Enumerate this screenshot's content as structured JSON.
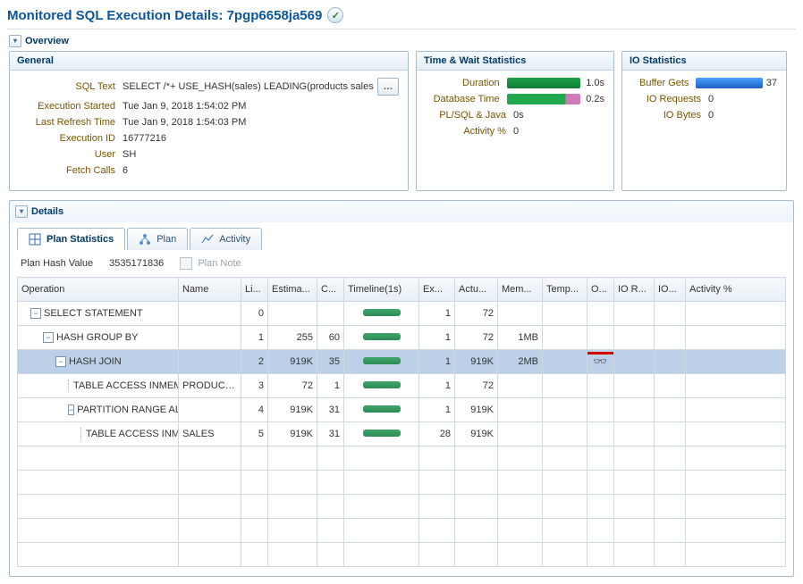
{
  "title": "Monitored SQL Execution Details: 7pgp6658ja569",
  "sections": {
    "overview": "Overview",
    "details": "Details"
  },
  "general": {
    "heading": "General",
    "labels": {
      "sql_text": "SQL Text",
      "exec_started": "Execution Started",
      "last_refresh": "Last Refresh Time",
      "exec_id": "Execution ID",
      "user": "User",
      "fetch_calls": "Fetch Calls"
    },
    "values": {
      "sql_text": "SELECT /*+ USE_HASH(sales) LEADING(products sales",
      "exec_started": "Tue Jan 9, 2018 1:54:02 PM",
      "last_refresh": "Tue Jan 9, 2018 1:54:03 PM",
      "exec_id": "16777216",
      "user": "SH",
      "fetch_calls": "6"
    }
  },
  "tw": {
    "heading": "Time & Wait Statistics",
    "labels": {
      "duration": "Duration",
      "db_time": "Database Time",
      "plsql": "PL/SQL & Java",
      "activity": "Activity %"
    },
    "values": {
      "duration": "1.0s",
      "db_time": "0.2s",
      "plsql": "0s",
      "activity": "0"
    }
  },
  "io": {
    "heading": "IO Statistics",
    "labels": {
      "buffer_gets": "Buffer Gets",
      "io_requests": "IO Requests",
      "io_bytes": "IO Bytes"
    },
    "values": {
      "buffer_gets": "37",
      "io_requests": "0",
      "io_bytes": "0"
    }
  },
  "tabs": {
    "plan_stats": "Plan Statistics",
    "plan": "Plan",
    "activity": "Activity"
  },
  "plan_hash": {
    "label": "Plan Hash Value",
    "value": "3535171836"
  },
  "plan_note": "Plan Note",
  "columns": {
    "operation": "Operation",
    "name": "Name",
    "li": "Li...",
    "estim": "Estima...",
    "c": "C...",
    "timeline": "Timeline(1s)",
    "ex": "Ex...",
    "actu": "Actu...",
    "mem": "Mem...",
    "temp": "Temp...",
    "o": "O...",
    "ior": "IO R...",
    "io": "IO...",
    "activity": "Activity %"
  },
  "rows": [
    {
      "indent": 0,
      "toggle": "-",
      "op": "SELECT STATEMENT",
      "name": "",
      "li": "0",
      "est": "",
      "c": "",
      "tl": true,
      "ex": "1",
      "act": "72",
      "mem": "",
      "o": ""
    },
    {
      "indent": 1,
      "toggle": "-",
      "op": "HASH GROUP BY",
      "name": "",
      "li": "1",
      "est": "255",
      "c": "60",
      "tl": true,
      "ex": "1",
      "act": "72",
      "mem": "1MB",
      "o": ""
    },
    {
      "indent": 2,
      "toggle": "-",
      "op": "HASH JOIN",
      "name": "",
      "li": "2",
      "est": "919K",
      "c": "35",
      "tl": true,
      "ex": "1",
      "act": "919K",
      "mem": "2MB",
      "o": "binoc",
      "selected": true
    },
    {
      "indent": 3,
      "toggle": "",
      "op": "TABLE ACCESS INMEM...",
      "name": "PRODUCTS",
      "li": "3",
      "est": "72",
      "c": "1",
      "tl": true,
      "ex": "1",
      "act": "72",
      "mem": "",
      "o": ""
    },
    {
      "indent": 3,
      "toggle": "-",
      "op": "PARTITION RANGE ALL",
      "name": "",
      "li": "4",
      "est": "919K",
      "c": "31",
      "tl": true,
      "ex": "1",
      "act": "919K",
      "mem": "",
      "o": ""
    },
    {
      "indent": 4,
      "toggle": "",
      "op": "TABLE ACCESS INM...",
      "name": "SALES",
      "li": "5",
      "est": "919K",
      "c": "31",
      "tl": true,
      "ex": "28",
      "act": "919K",
      "mem": "",
      "o": ""
    }
  ]
}
